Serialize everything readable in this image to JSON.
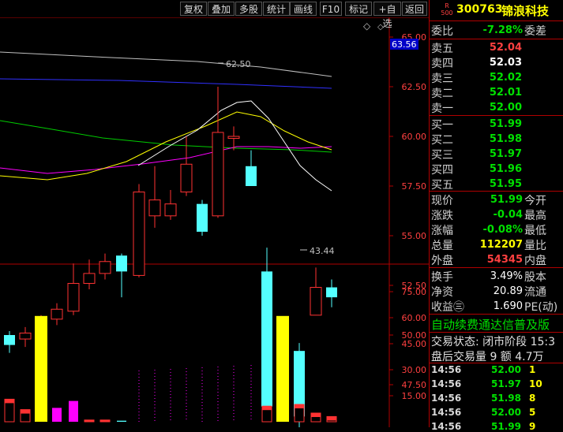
{
  "toolbar": [
    "复权",
    "叠加",
    "多股",
    "统计",
    "画线",
    "F10",
    "标记",
    "+自选",
    "返回"
  ],
  "chart": {
    "price_axis": [
      "65.00",
      "62.50",
      "60.00",
      "57.50",
      "55.00",
      "52.50",
      "50.00",
      "47.50",
      "45.00"
    ],
    "vol_axis": [
      "75.00",
      "60.00",
      "45.00",
      "30.00",
      "15.00"
    ],
    "current_price_tag": "63.56",
    "high_label": "62.50",
    "low_label": "43.44",
    "marker_glyph": "◇",
    "colors": {
      "up": "#ff3232",
      "down": "#54ffff",
      "ma5": "#ffffff",
      "ma10": "#ffff00",
      "ma20": "#ff00ff",
      "ma30": "#00cc00",
      "ma60": "#c0c0c0",
      "ma120": "#3030ff",
      "vol_bar": "#ffff00"
    }
  },
  "stock": {
    "r_badge_top": "R",
    "r_badge_bottom": "500",
    "code": "300763",
    "name": "锦浪科技"
  },
  "quote": {
    "weibi_label": "委比",
    "weibi_value": "-7.28%",
    "weicha_label": "委差",
    "asks": [
      {
        "label": "卖五",
        "price": "52.04"
      },
      {
        "label": "卖四",
        "price": "52.03"
      },
      {
        "label": "卖三",
        "price": "52.02"
      },
      {
        "label": "卖二",
        "price": "52.01"
      },
      {
        "label": "卖一",
        "price": "52.00"
      }
    ],
    "bids": [
      {
        "label": "买一",
        "price": "51.99"
      },
      {
        "label": "买二",
        "price": "51.98"
      },
      {
        "label": "买三",
        "price": "51.97"
      },
      {
        "label": "买四",
        "price": "51.96"
      },
      {
        "label": "买五",
        "price": "51.95"
      }
    ],
    "stats": [
      {
        "l1": "现价",
        "v": "51.99",
        "l2": "今开",
        "color": "green"
      },
      {
        "l1": "涨跌",
        "v": "-0.04",
        "l2": "最高",
        "color": "green"
      },
      {
        "l1": "涨幅",
        "v": "-0.08%",
        "l2": "最低",
        "color": "green"
      },
      {
        "l1": "总量",
        "v": "112207",
        "l2": "量比",
        "color": "yellow"
      },
      {
        "l1": "外盘",
        "v": "54345",
        "l2": "内盘",
        "color": "red"
      }
    ],
    "stats2": [
      {
        "l1": "换手",
        "v": "3.49%",
        "l2": "股本"
      },
      {
        "l1": "净资",
        "v": "20.89",
        "l2": "流通"
      },
      {
        "l1": "收益㊂",
        "v": "1.690",
        "l2": "PE(动)"
      }
    ],
    "banner": "自动续费通达信普及版",
    "status_line": "交易状态: 闭市阶段 15:3",
    "after_hours": "盘后交易量 9 额 4.7万",
    "ticks": [
      {
        "time": "14:56",
        "price": "52.00",
        "vol": "1",
        "color": "green"
      },
      {
        "time": "14:56",
        "price": "51.97",
        "vol": "10",
        "color": "green"
      },
      {
        "time": "14:56",
        "price": "51.98",
        "vol": "8",
        "color": "green"
      },
      {
        "time": "14:56",
        "price": "52.00",
        "vol": "5",
        "color": "green"
      },
      {
        "time": "14:56",
        "price": "51.99",
        "vol": "9",
        "color": "green"
      }
    ]
  }
}
